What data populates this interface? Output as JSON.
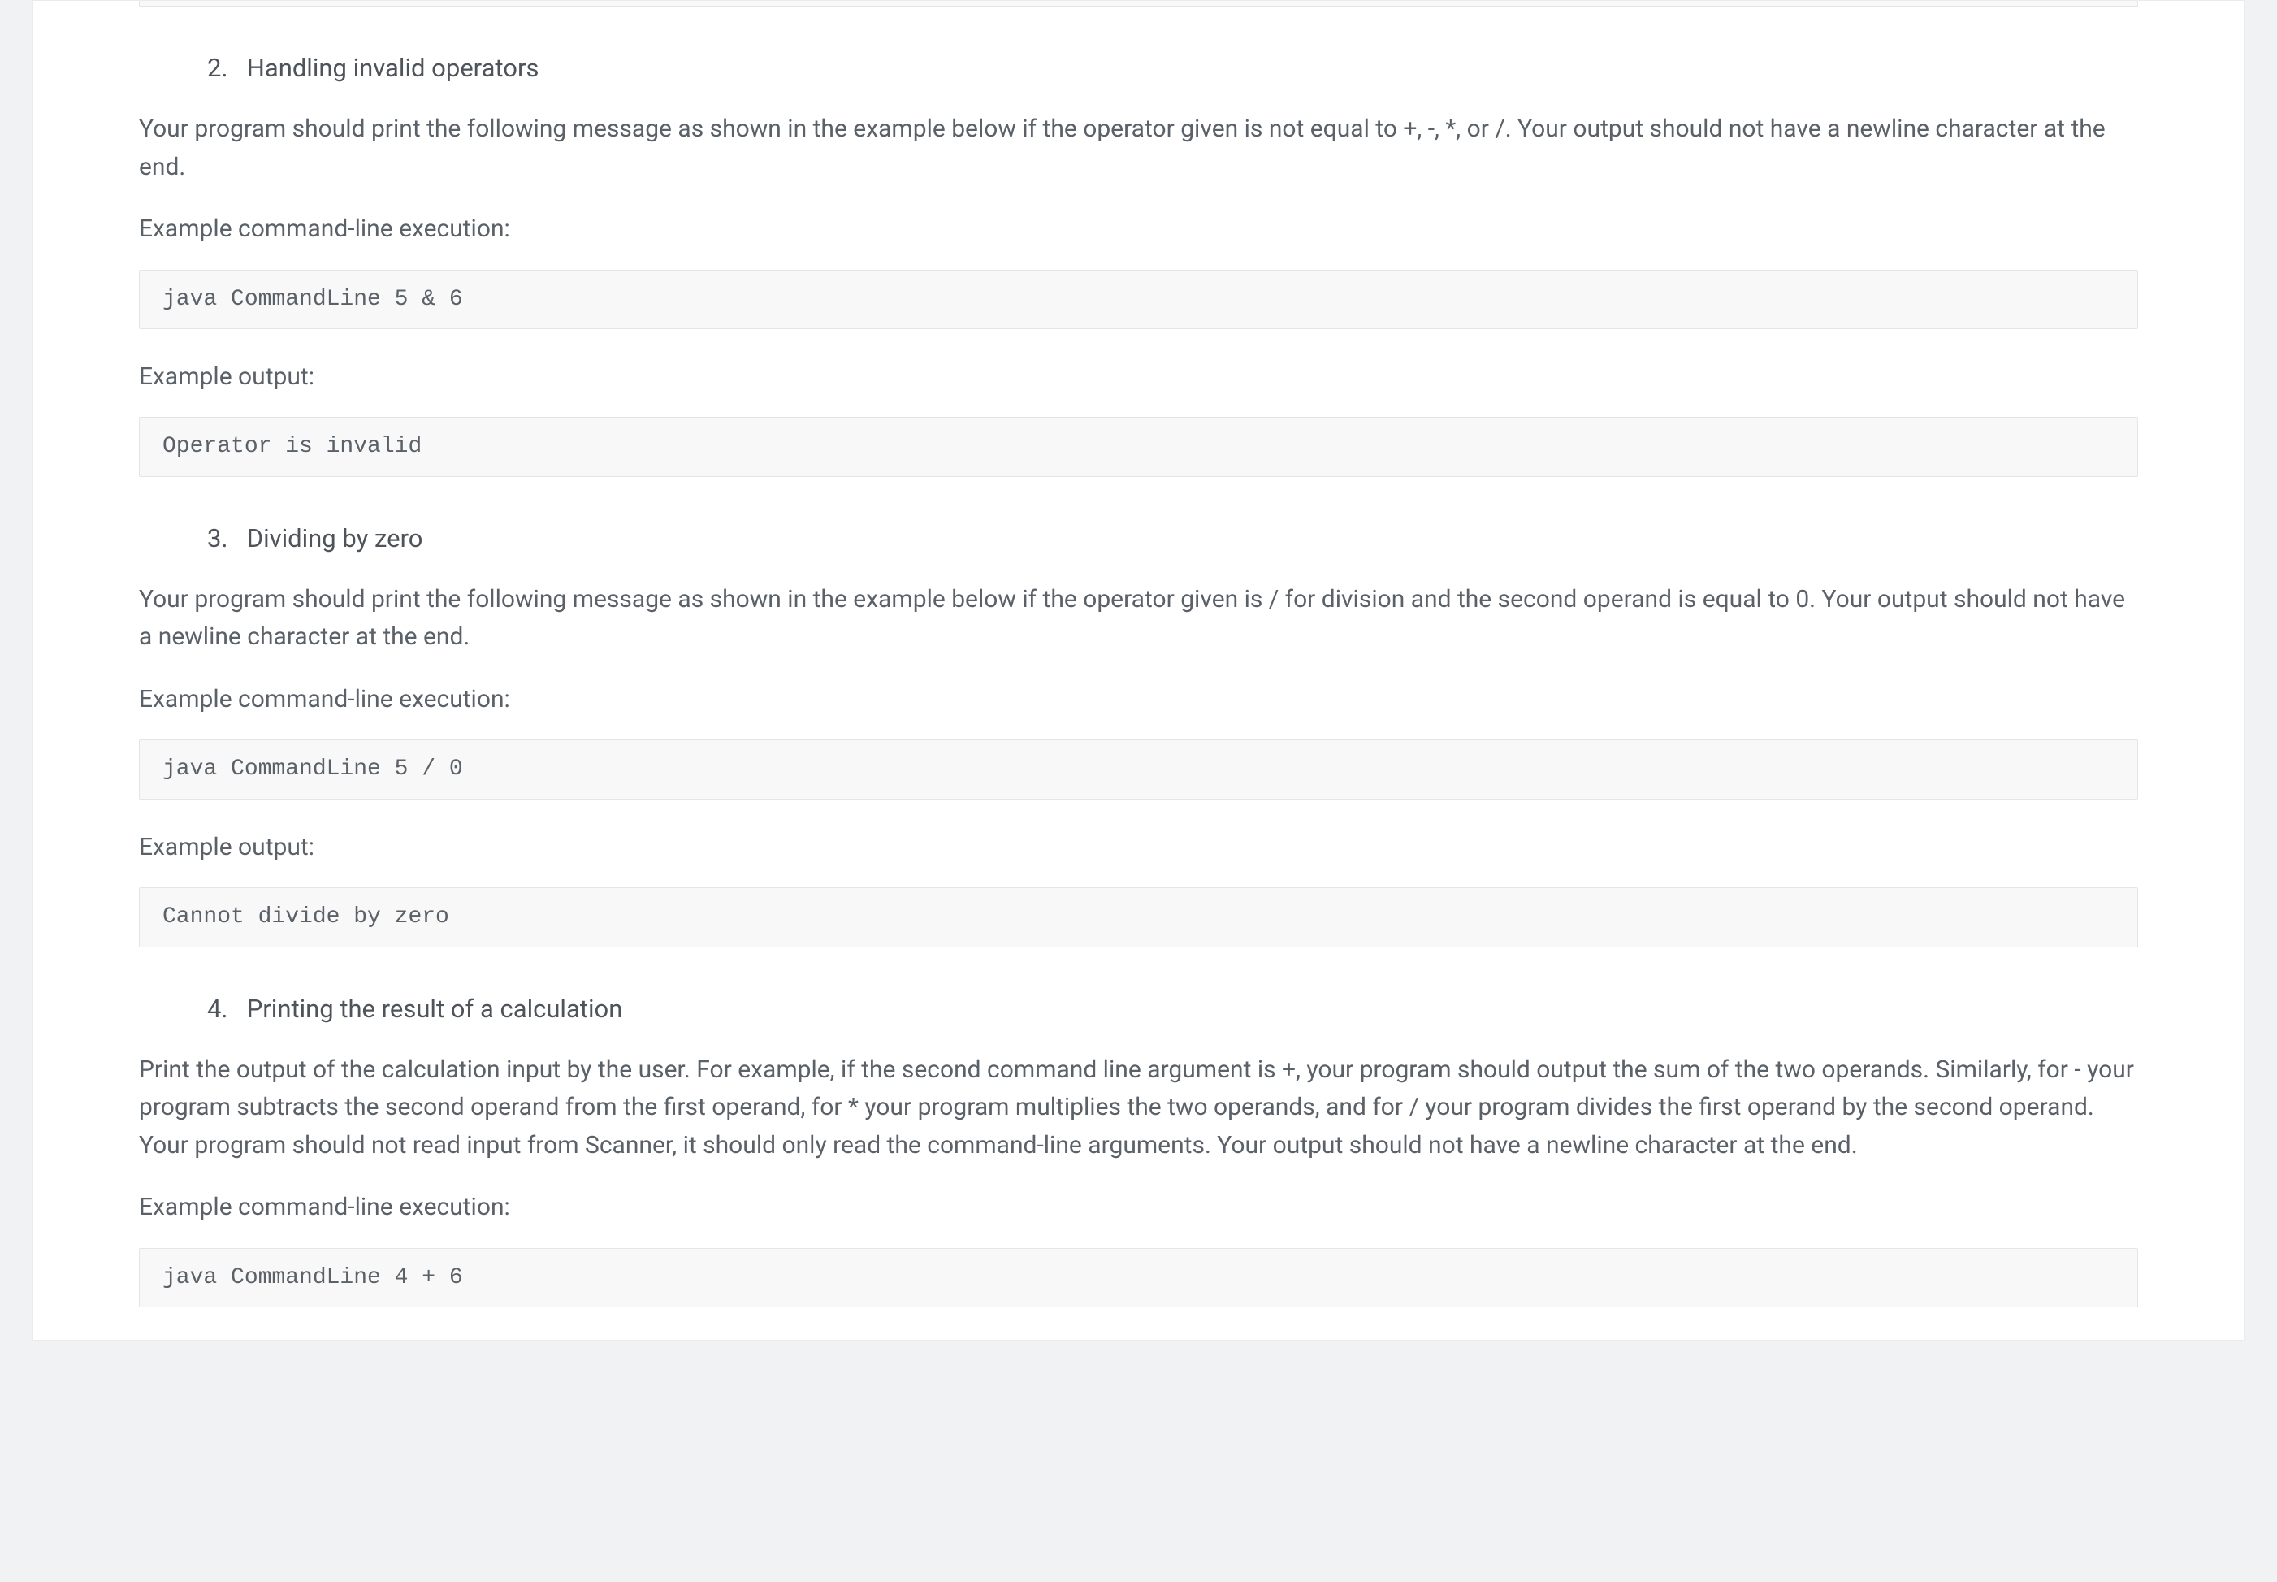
{
  "sections": [
    {
      "number": "2.",
      "title": "Handling invalid operators",
      "description_parts": [
        "Your program should print the following message as shown in the example below if the operator given is not equal to +, -, *, or /. Your output should not have a newline character at the end."
      ],
      "example_cmd_label": "Example command-line execution:",
      "example_cmd": "java CommandLine 5 & 6",
      "example_out_label": "Example output:",
      "example_out": "Operator is invalid"
    },
    {
      "number": "3.",
      "title": "Dividing by zero",
      "description_parts": [
        "Your program should print the following message as shown in the example below if the operator given is / for division and the second operand is equal to 0. Your output should not have a newline character at the end."
      ],
      "example_cmd_label": "Example command-line execution:",
      "example_cmd": "java CommandLine 5 / 0",
      "example_out_label": "Example output:",
      "example_out": "Cannot divide by zero"
    },
    {
      "number": "4.",
      "title": "Printing the result of a calculation",
      "description_parts": [
        "Print the output of the calculation input by the user. For example, if the second command line argument is +, your program should output the sum of the two operands. Similarly, for - your program subtracts the second operand from the first operand, for * your program multiplies the two operands, and for / your program divides the first operand by the second operand. Your program should not read input from Scanner, it should only read the command-line arguments. Your output should not have a newline character at the end."
      ],
      "example_cmd_label": "Example command-line execution:",
      "example_cmd": "java CommandLine 4 + 6",
      "example_out_label": "",
      "example_out": ""
    }
  ]
}
